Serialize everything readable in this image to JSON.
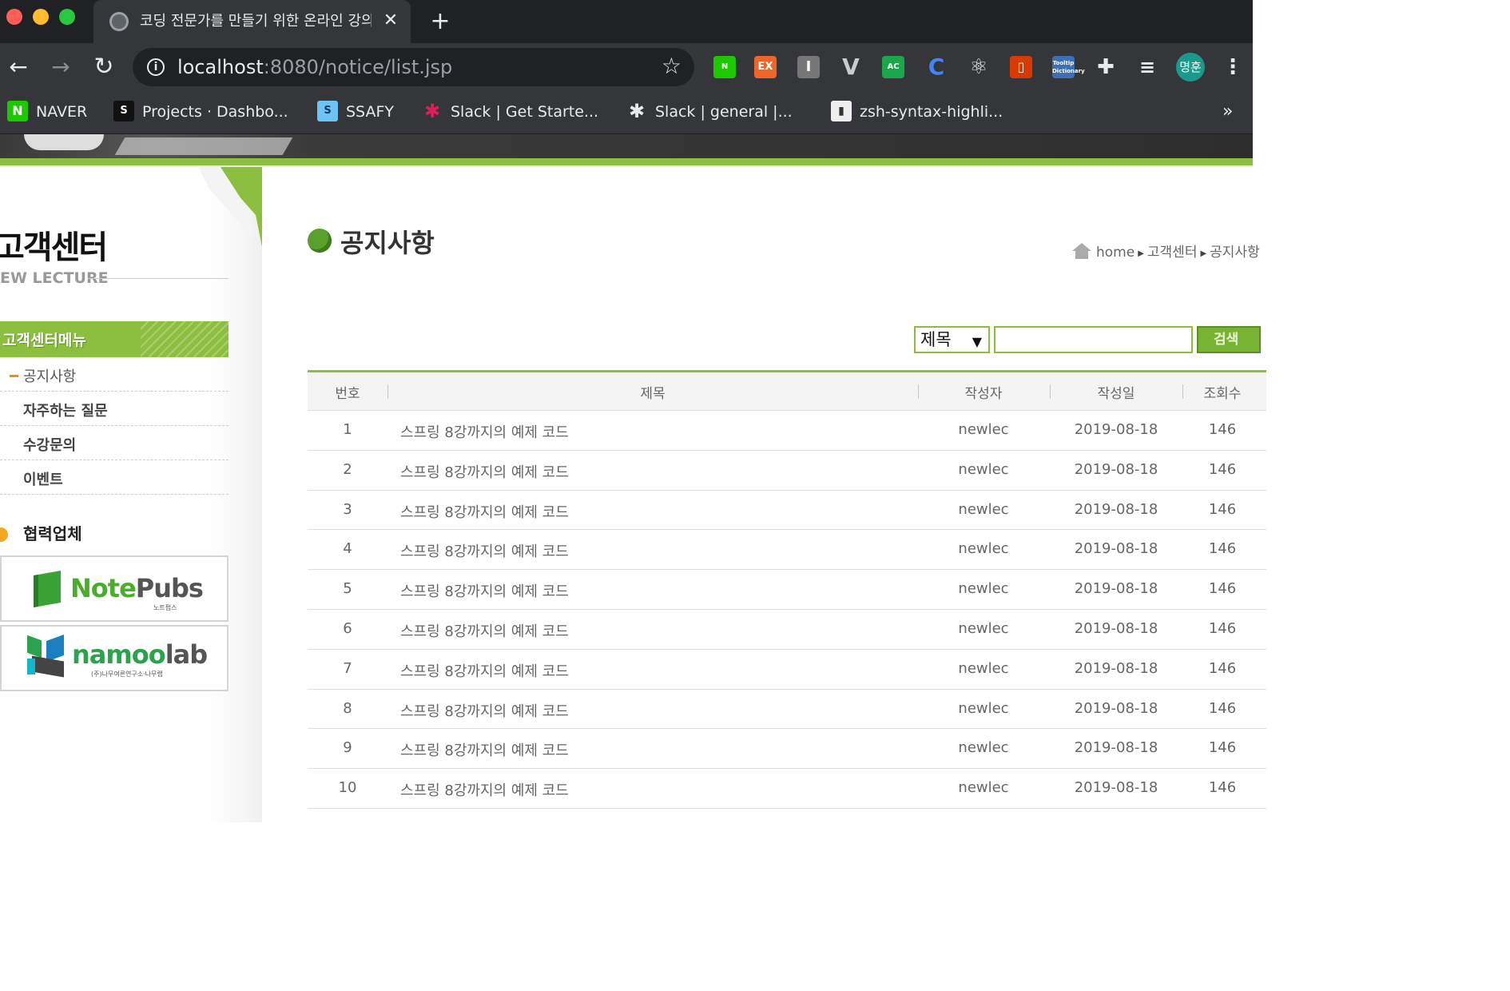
{
  "browser": {
    "tab_title": "코딩 전문가를 만들기 위한 온라인 강의",
    "tab_close": "✕",
    "new_tab": "+",
    "url_host": "localhost",
    "url_rest": ":8080/notice/list.jsp",
    "profile_label": "명훈",
    "bookmarks": [
      {
        "icon": "N",
        "label": "NAVER"
      },
      {
        "icon": "S",
        "label": "Projects · Dashbo..."
      },
      {
        "icon": "S",
        "label": "SSAFY"
      },
      {
        "icon": "✱",
        "label": "Slack | Get Starte..."
      },
      {
        "icon": "✱",
        "label": "Slack | general |..."
      },
      {
        "icon": "▮",
        "label": "zsh-syntax-highli..."
      }
    ],
    "bookmarks_more": "»",
    "extensions": [
      "N",
      "EX",
      "I",
      "V",
      "AC",
      "C",
      "⚛",
      "▯",
      "Tooltip Dictionary",
      "✚",
      "≡"
    ]
  },
  "sidebar": {
    "title": "고객센터",
    "subtitle": "EW LECTURE",
    "menu_heading": "고객센터메뉴",
    "menu_items": [
      {
        "label": "공지사항"
      },
      {
        "label": "자주하는 질문"
      },
      {
        "label": "수강문의"
      },
      {
        "label": "이벤트"
      }
    ],
    "partners_title": "협력업체",
    "partner_logos": [
      {
        "name_a": "Note",
        "name_b": "Pubs",
        "sub": "노트펍스"
      },
      {
        "name_a": "namoo",
        "name_b": "lab",
        "sub": "(주)나무여른연구소·나무랩"
      }
    ]
  },
  "main": {
    "title": "공지사항",
    "breadcrumb": [
      "home",
      "고객센터",
      "공지사항"
    ],
    "search": {
      "field_selected": "제목",
      "query": "",
      "button_label": "검색"
    },
    "table": {
      "headers": [
        "번호",
        "제목",
        "작성자",
        "작성일",
        "조회수"
      ],
      "rows": [
        {
          "num": "1",
          "title": "스프링 8강까지의 예제 코드",
          "writer": "newlec",
          "date": "2019-08-18",
          "hit": "146"
        },
        {
          "num": "2",
          "title": "스프링 8강까지의 예제 코드",
          "writer": "newlec",
          "date": "2019-08-18",
          "hit": "146"
        },
        {
          "num": "3",
          "title": "스프링 8강까지의 예제 코드",
          "writer": "newlec",
          "date": "2019-08-18",
          "hit": "146"
        },
        {
          "num": "4",
          "title": "스프링 8강까지의 예제 코드",
          "writer": "newlec",
          "date": "2019-08-18",
          "hit": "146"
        },
        {
          "num": "5",
          "title": "스프링 8강까지의 예제 코드",
          "writer": "newlec",
          "date": "2019-08-18",
          "hit": "146"
        },
        {
          "num": "6",
          "title": "스프링 8강까지의 예제 코드",
          "writer": "newlec",
          "date": "2019-08-18",
          "hit": "146"
        },
        {
          "num": "7",
          "title": "스프링 8강까지의 예제 코드",
          "writer": "newlec",
          "date": "2019-08-18",
          "hit": "146"
        },
        {
          "num": "8",
          "title": "스프링 8강까지의 예제 코드",
          "writer": "newlec",
          "date": "2019-08-18",
          "hit": "146"
        },
        {
          "num": "9",
          "title": "스프링 8강까지의 예제 코드",
          "writer": "newlec",
          "date": "2019-08-18",
          "hit": "146"
        },
        {
          "num": "10",
          "title": "스프링 8강까지의 예제 코드",
          "writer": "newlec",
          "date": "2019-08-18",
          "hit": "146"
        }
      ]
    }
  },
  "colors": {
    "accent_green": "#8cbf3f",
    "orange": "#f08a1c"
  }
}
